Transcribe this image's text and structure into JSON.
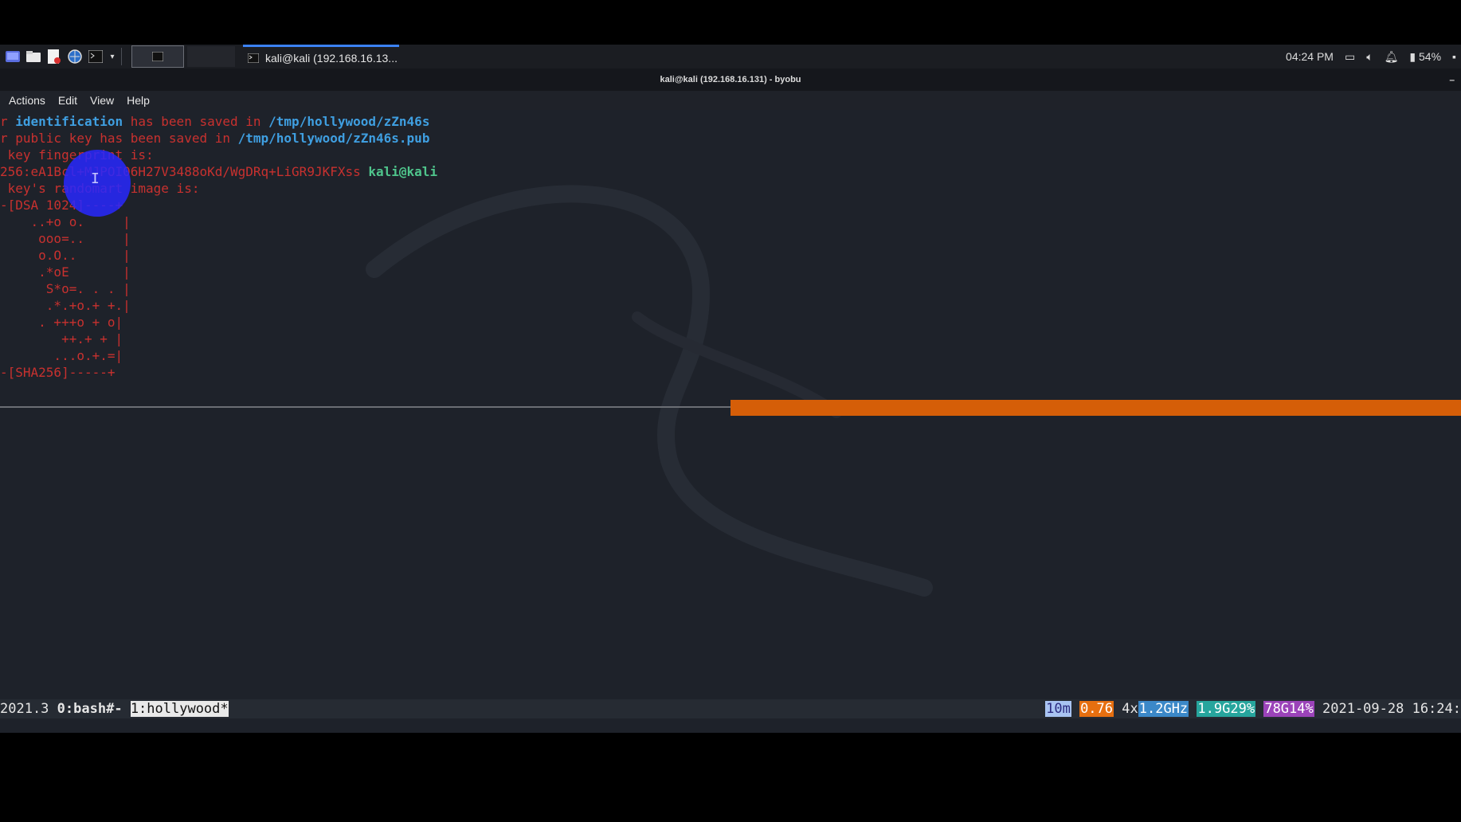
{
  "taskbar": {
    "launchers": [
      "desktop-icon",
      "folder-icon",
      "text-editor-icon",
      "browser-icon",
      "terminal-icon"
    ],
    "task_title": "kali@kali (192.168.16.13...",
    "clock": "04:24 PM",
    "battery": "54%"
  },
  "window": {
    "title": "kali@kali (192.168.16.131) - byobu",
    "minimize": "–"
  },
  "menu": {
    "items": [
      "Actions",
      "Edit",
      "View",
      "Help"
    ]
  },
  "terminal": {
    "lines": [
      {
        "segments": [
          {
            "text": "r ",
            "style": "red"
          },
          {
            "text": "identification",
            "style": "blue"
          },
          {
            "text": " has been saved in ",
            "style": "red"
          },
          {
            "text": "/tmp/hollywood/zZn46s",
            "style": "blue"
          }
        ]
      },
      {
        "segments": [
          {
            "text": "r public key has been saved in ",
            "style": "red"
          },
          {
            "text": "/tmp/hollywood/zZn46s.pub",
            "style": "blue"
          }
        ]
      },
      {
        "segments": [
          {
            "text": " key fingerprint is:",
            "style": "red"
          }
        ]
      },
      {
        "segments": [
          {
            "text": "256:eA1Bcl+MJPOI06H27V3488oKd/WgDRq+LiGR9JKFXss ",
            "style": "red"
          },
          {
            "text": "kali@kali",
            "style": "green"
          }
        ]
      },
      {
        "segments": [
          {
            "text": " key's randomart image is:",
            "style": "red"
          }
        ]
      },
      {
        "segments": [
          {
            "text": "-[DSA 1024]----+",
            "style": "red"
          }
        ]
      },
      {
        "segments": [
          {
            "text": "    ..+o o.     |",
            "style": "red"
          }
        ]
      },
      {
        "segments": [
          {
            "text": "     ooo=..     |",
            "style": "red"
          }
        ]
      },
      {
        "segments": [
          {
            "text": "     o.O..      |",
            "style": "red"
          }
        ]
      },
      {
        "segments": [
          {
            "text": "     .*oE       |",
            "style": "red"
          }
        ]
      },
      {
        "segments": [
          {
            "text": "      S*o=. . . |",
            "style": "red"
          }
        ]
      },
      {
        "segments": [
          {
            "text": "      .*.+o.+ +.|",
            "style": "red"
          }
        ]
      },
      {
        "segments": [
          {
            "text": "     . +++o + o|",
            "style": "red"
          }
        ]
      },
      {
        "segments": [
          {
            "text": "        ++.+ + |",
            "style": "red"
          }
        ]
      },
      {
        "segments": [
          {
            "text": "       ...o.+.=|",
            "style": "red"
          }
        ]
      },
      {
        "segments": [
          {
            "text": "-[SHA256]-----+",
            "style": "red"
          }
        ]
      }
    ]
  },
  "status": {
    "version": "2021.3",
    "window0": "0:bash#-",
    "window1": "1:hollywood*",
    "uptime": "10m",
    "load": "0.76",
    "cpu_count": "4x",
    "cpu_freq": "1.2GHz",
    "mem": "1.9G29%",
    "disk": "78G14%",
    "datetime": "2021-09-28 16:24:"
  },
  "colors": {
    "terminal_bg": "#1e222a",
    "text_red": "#c8312f",
    "text_blue": "#3f9fe1",
    "text_green": "#4fc58c",
    "active_pane": "#d55e08"
  }
}
